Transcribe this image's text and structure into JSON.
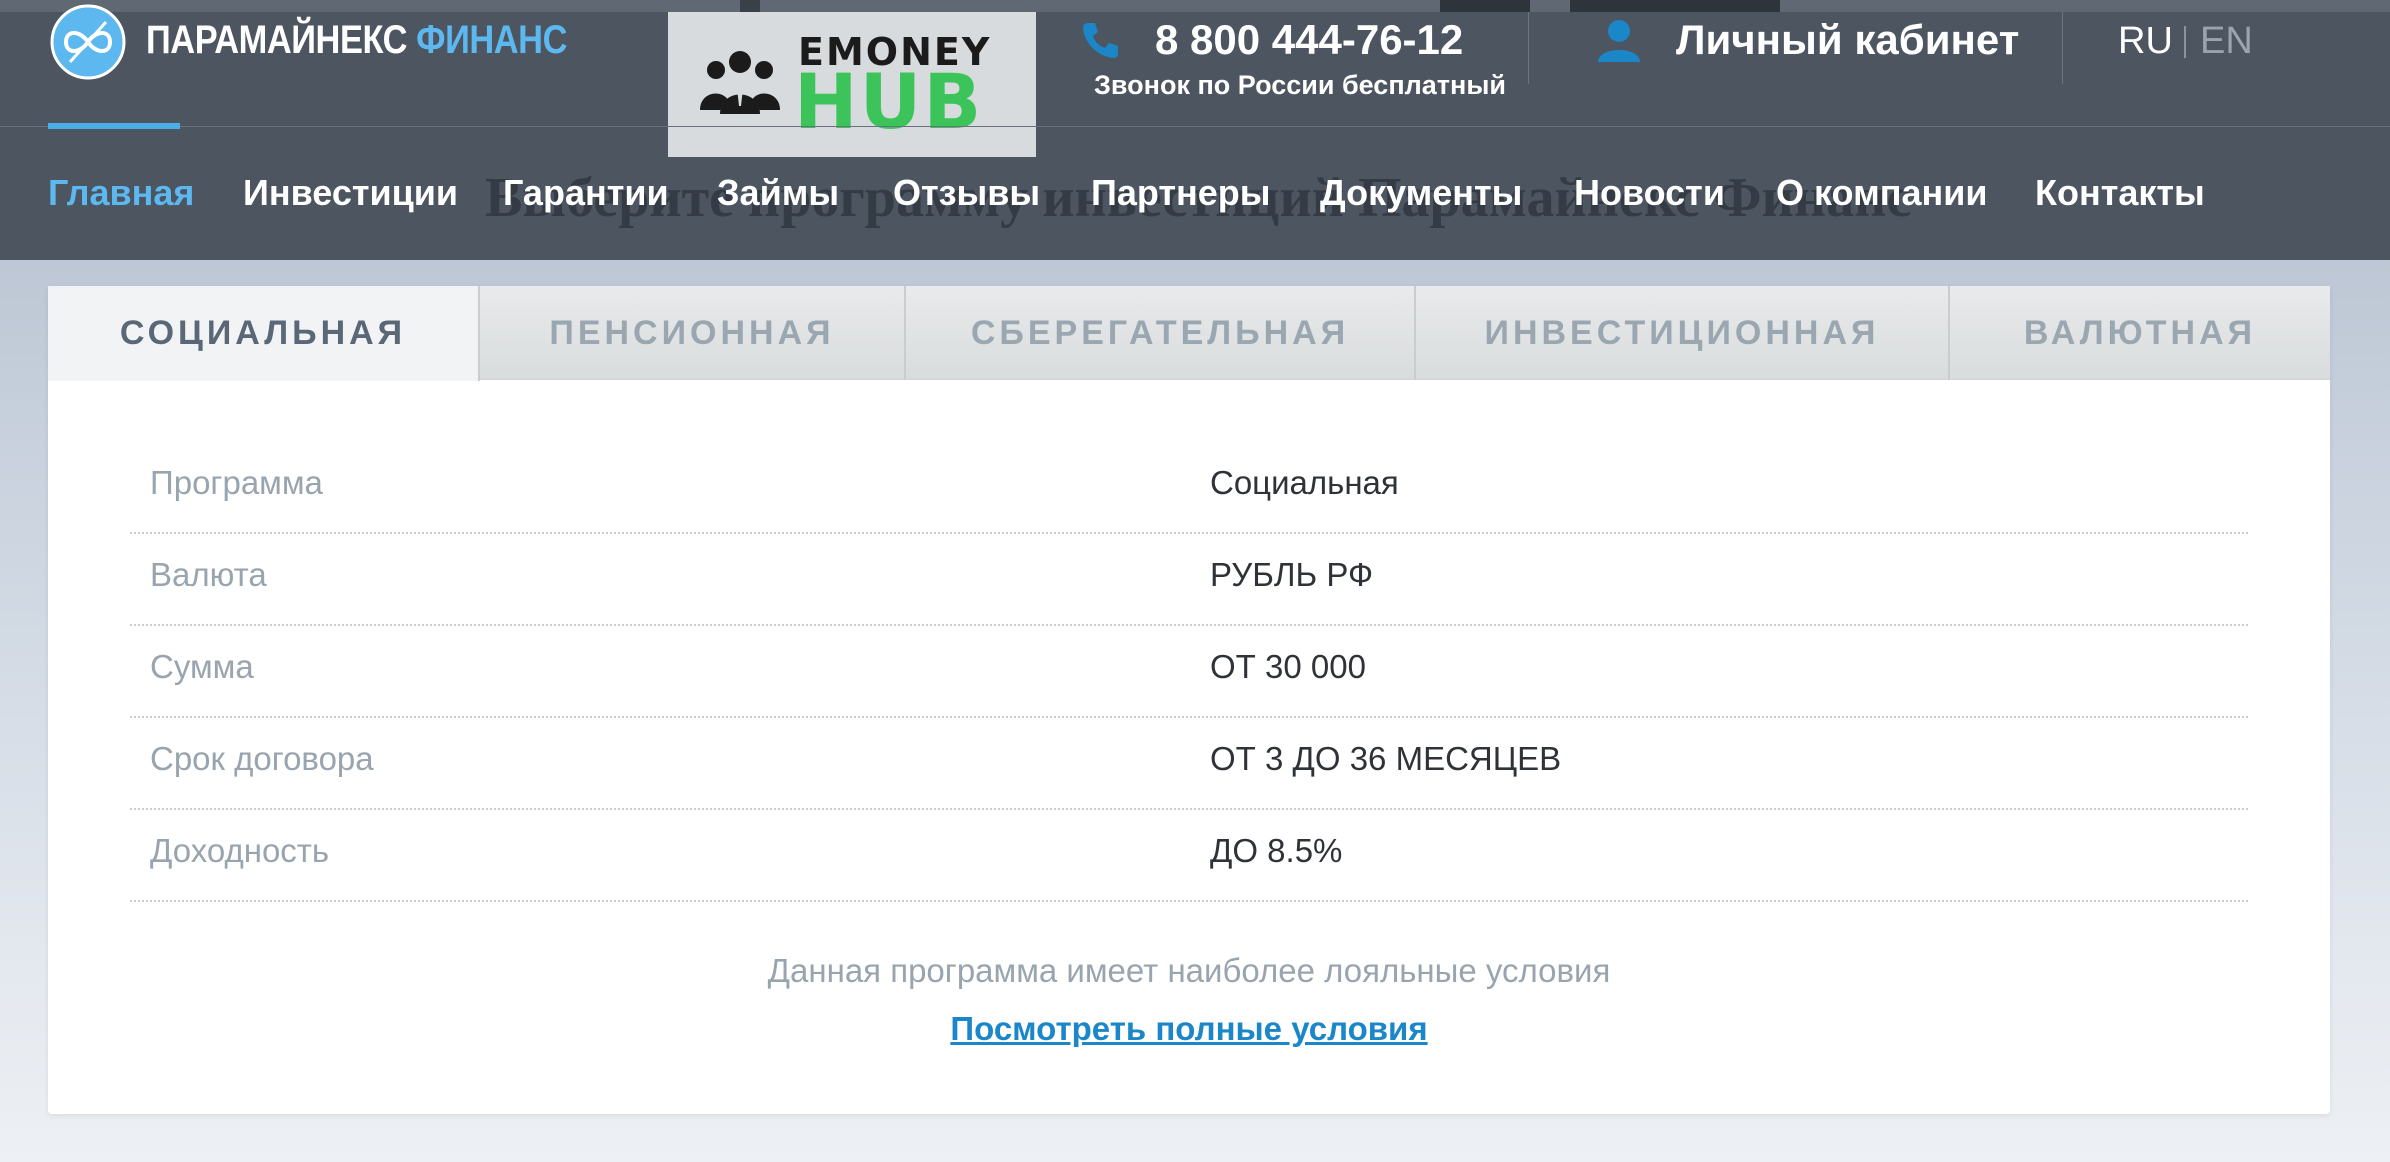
{
  "brand": {
    "name_main": "ПАРАМАЙНЕКС",
    "name_accent": "ФИНАНС"
  },
  "badge": {
    "line1": "EMONEY",
    "line2": "HUB",
    "icon": "people-group-icon"
  },
  "contact": {
    "phone": "8 800 444-76-12",
    "phone_note": "Звонок по России бесплатный",
    "icon": "phone-icon"
  },
  "account": {
    "label": "Личный кабинет",
    "icon": "user-icon"
  },
  "languages": [
    "RU",
    "EN"
  ],
  "nav": {
    "items": [
      "Главная",
      "Инвестиции",
      "Гарантии",
      "Займы",
      "Отзывы",
      "Партнеры",
      "Документы",
      "Новости",
      "О компании",
      "Контакты"
    ],
    "active_index": 0
  },
  "ghost_title": "Выберите программу инвестиций Парамайнекс Финанс",
  "tabs": {
    "items": [
      "СОЦИАЛЬНАЯ",
      "ПЕНСИОННАЯ",
      "СБЕРЕГАТЕЛЬНАЯ",
      "ИНВЕСТИЦИОННАЯ",
      "ВАЛЮТНАЯ"
    ],
    "active_index": 0
  },
  "program_table": [
    {
      "label": "Программа",
      "value": "Социальная"
    },
    {
      "label": "Валюта",
      "value": "РУБЛЬ РФ"
    },
    {
      "label": "Сумма",
      "value": "ОТ 30 000"
    },
    {
      "label": "Срок договора",
      "value": "ОТ 3 ДО 36 МЕСЯЦЕВ"
    },
    {
      "label": "Доходность",
      "value": "ДО 8.5%"
    }
  ],
  "note": "Данная программа имеет наиболее лояльные условия",
  "terms_link": "Посмотреть полные условия",
  "colors": {
    "header_bg": "#4c5560",
    "accent_blue": "#5db8f0",
    "link_blue": "#1b87c9",
    "hub_green": "#3cc45a"
  }
}
